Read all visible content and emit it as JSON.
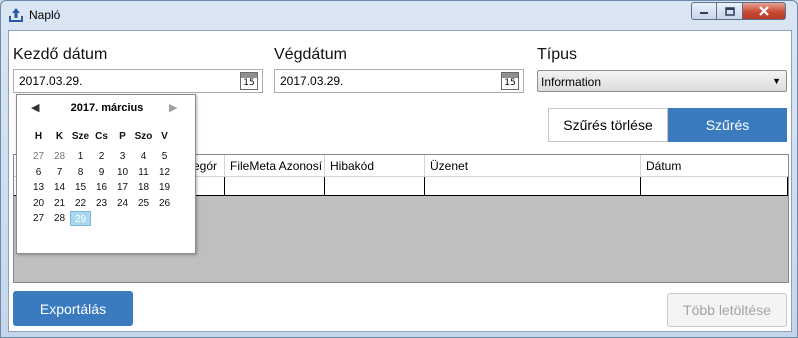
{
  "window": {
    "title": "Napló"
  },
  "filters": {
    "start_label": "Kezdő dátum",
    "start_value": "2017.03.29.",
    "end_label": "Végdátum",
    "end_value": "2017.03.29.",
    "calendar_icon_num": "15",
    "type_label": "Típus",
    "type_value": "Information"
  },
  "buttons": {
    "clear": "Szűrés törlése",
    "filter": "Szűrés",
    "export": "Exportálás",
    "more": "Több letöltése"
  },
  "grid": {
    "columns": [
      "Kategór",
      "FileMeta Azonosí",
      "Hibakód",
      "Üzenet",
      "Dátum"
    ]
  },
  "calendar": {
    "title": "2017. március",
    "weekdays": [
      "H",
      "K",
      "Sze",
      "Cs",
      "P",
      "Szo",
      "V"
    ],
    "weeks": [
      [
        "27",
        "28",
        "1",
        "2",
        "3",
        "4",
        "5"
      ],
      [
        "6",
        "7",
        "8",
        "9",
        "10",
        "11",
        "12"
      ],
      [
        "13",
        "14",
        "15",
        "16",
        "17",
        "18",
        "19"
      ],
      [
        "20",
        "21",
        "22",
        "23",
        "24",
        "25",
        "26"
      ],
      [
        "27",
        "28",
        "29",
        "",
        "",
        "",
        ""
      ]
    ],
    "selected_day": "29"
  },
  "colors": {
    "accent": "#3a7bbf",
    "today_highlight": "#a9d7ef",
    "disabled_text": "#a3a3a3"
  }
}
